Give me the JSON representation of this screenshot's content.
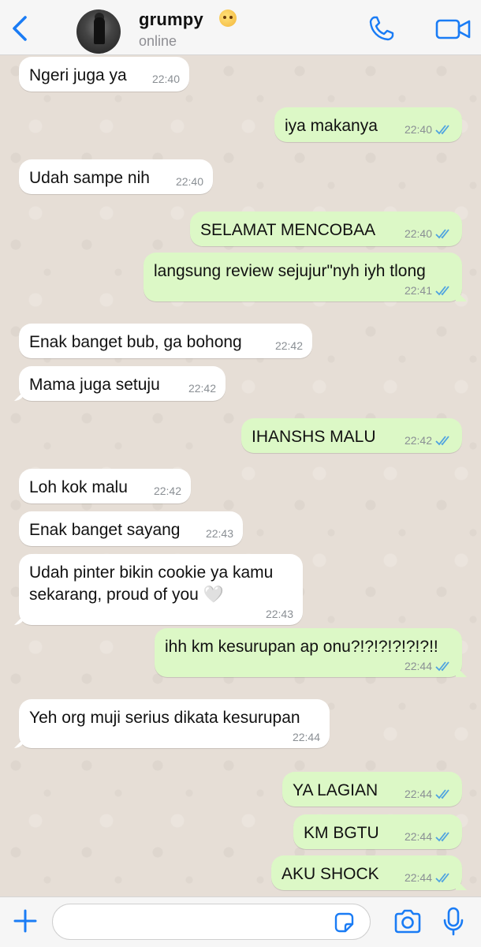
{
  "header": {
    "contact_name": "grumpy",
    "status": "online",
    "status_emoji": "woozy-face-emoji",
    "icons": [
      "back-chevron-icon",
      "phone-icon",
      "video-camera-icon"
    ],
    "accent_color": "#1a7cf5"
  },
  "messages": [
    {
      "dir": "in",
      "text": "Ngeri juga ya",
      "time": "22:40"
    },
    {
      "dir": "out",
      "text": "iya makanya",
      "time": "22:40",
      "read": true
    },
    {
      "dir": "in",
      "text": "Udah sampe nih",
      "time": "22:40"
    },
    {
      "dir": "out",
      "text": "SELAMAT MENCOBAA",
      "time": "22:40",
      "read": true
    },
    {
      "dir": "out",
      "text": "langsung review sejujur\"nyh iyh tlong",
      "time": "22:41",
      "read": true
    },
    {
      "dir": "in",
      "text": "Enak banget bub, ga bohong",
      "time": "22:42"
    },
    {
      "dir": "in",
      "text": "Mama juga setuju",
      "time": "22:42"
    },
    {
      "dir": "out",
      "text": "IHANSHS MALU",
      "time": "22:42",
      "read": true
    },
    {
      "dir": "in",
      "text": "Loh kok malu",
      "time": "22:42"
    },
    {
      "dir": "in",
      "text": "Enak banget sayang",
      "time": "22:43"
    },
    {
      "dir": "in",
      "text": "Udah pinter bikin cookie ya kamu sekarang, proud of you 🤍",
      "time": "22:43"
    },
    {
      "dir": "out",
      "text": "ihh km kesurupan ap onu?!?!?!?!?!?!!",
      "time": "22:44",
      "read": true
    },
    {
      "dir": "in",
      "text": "Yeh org muji serius dikata kesurupan",
      "time": "22:44"
    },
    {
      "dir": "out",
      "text": "YA LAGIAN",
      "time": "22:44",
      "read": true
    },
    {
      "dir": "out",
      "text": "KM BGTU",
      "time": "22:44",
      "read": true
    },
    {
      "dir": "out",
      "text": "AKU SHOCK",
      "time": "22:44",
      "read": true
    }
  ],
  "composer": {
    "placeholder": "",
    "icons": [
      "plus-icon",
      "sticker-icon",
      "camera-icon",
      "microphone-icon"
    ]
  },
  "colors": {
    "incoming_bubble": "#ffffff",
    "outgoing_bubble": "#dcf8c6",
    "read_tick": "#4fa3e0",
    "chat_background": "#e6ded6"
  }
}
